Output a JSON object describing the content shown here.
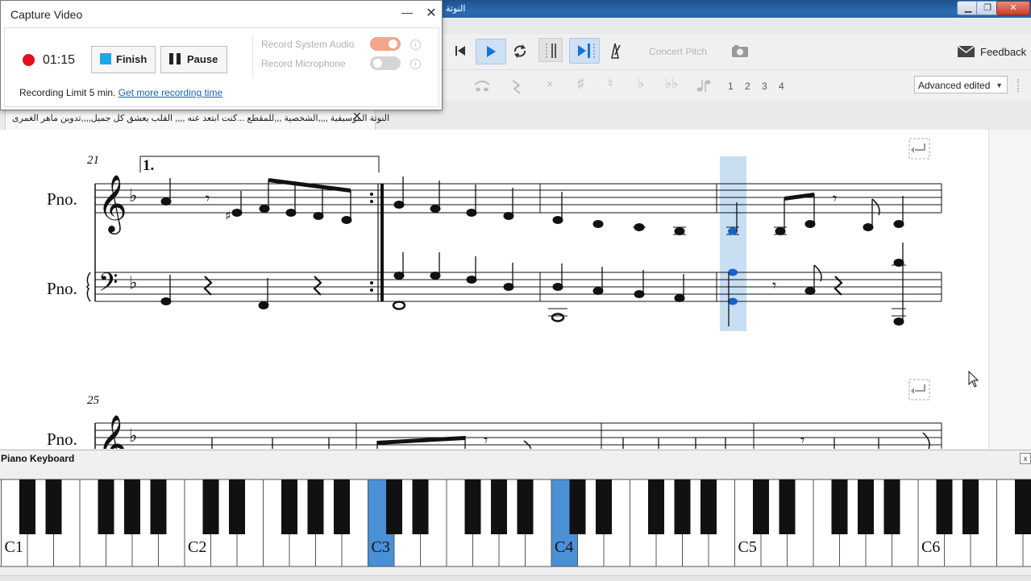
{
  "capture": {
    "title": "Capture Video",
    "timer": "01:15",
    "finish_label": "Finish",
    "pause_label": "Pause",
    "record_system_audio": "Record System Audio",
    "record_microphone": "Record Microphone",
    "system_audio_on": true,
    "microphone_on": false,
    "limit_text": "Recording Limit 5 min.",
    "more_link": "Get more recording time",
    "info_glyph": "i",
    "min_glyph": "—",
    "close_glyph": "✕"
  },
  "window": {
    "title_fragment": "النوتة",
    "min_glyph": "▁",
    "max_glyph": "❐",
    "close_glyph": "✕"
  },
  "toolbar": {
    "concert_pitch": "Concert Pitch",
    "feedback": "Feedback",
    "voice_numbers": [
      "1",
      "2",
      "3",
      "4"
    ],
    "view_mode": "Advanced edited",
    "accidental_icons": [
      "toggle-double-flat-icon",
      "toggle-sharp-icon",
      "toggle-natural-icon",
      "toggle-flat-icon",
      "toggle-double-sharp-icon"
    ],
    "accent_color": "#1473d9"
  },
  "tab": {
    "title": "النوتة الموسيقية ,,,,الشخصية ,,,للمقطع ...كنت ابتعد عنه ,,,, القلب يعشق كل جميل,,,,تدوين ماهر الغمرى",
    "close_glyph": "✕"
  },
  "score": {
    "system1": {
      "measure_number": "21",
      "volta": "1.",
      "treble_label": "Pno.",
      "bass_label": "Pno."
    },
    "system2": {
      "measure_number": "25",
      "treble_label": "Pno."
    },
    "selected_measure_color": "#c8def2",
    "note_selected_color": "#1464c8"
  },
  "piano": {
    "title": "Piano Keyboard",
    "close_glyph": "x",
    "octave_labels": [
      "C1",
      "C2",
      "C3",
      "C4",
      "C5",
      "C6"
    ],
    "highlighted_keys": [
      "C3",
      "C4"
    ],
    "highlight_color": "#4a90d6"
  }
}
